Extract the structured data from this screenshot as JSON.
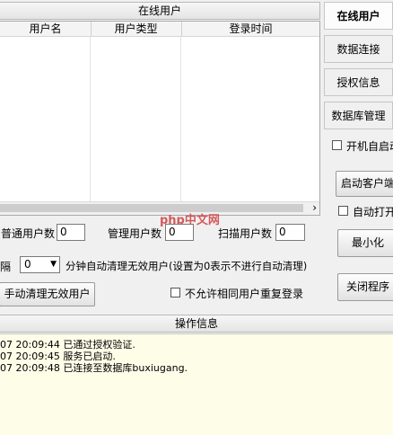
{
  "online_users_panel": {
    "title": "在线用户",
    "columns": [
      "用户名",
      "用户类型",
      "登录时间"
    ],
    "scroll_arrow": "›"
  },
  "counts": {
    "normal_users_label": "普通用户数",
    "normal_users_value": "0",
    "admin_users_label": "管理用户数",
    "admin_users_value": "0",
    "scan_users_label": "扫描用户数",
    "scan_users_value": "0"
  },
  "cleanup": {
    "interval_prefix": "隔",
    "interval_value": "0",
    "interval_suffix": "分钟自动清理无效用户(设置为0表示不进行自动清理)",
    "manual_button": "手动清理无效用户",
    "disallow_duplicate_label": "不允许相同用户重复登录"
  },
  "sidebar": {
    "tabs": [
      {
        "label": "在线用户",
        "active": true
      },
      {
        "label": "数据连接",
        "active": false
      },
      {
        "label": "授权信息",
        "active": false
      },
      {
        "label": "数据库管理",
        "active": false
      }
    ],
    "autostart_label": "开机自启动",
    "start_client_button": "启动客户端",
    "auto_open_label": "自动打开",
    "minimize_button": "最小化",
    "close_button": "关闭程序"
  },
  "log_panel": {
    "title": "操作信息",
    "lines": [
      "07 20:09:44  已通过授权验证.",
      "07 20:09:45  服务已启动.",
      "07 20:09:48  已连接至数据库buxiugang."
    ]
  },
  "watermark": "php中文网"
}
